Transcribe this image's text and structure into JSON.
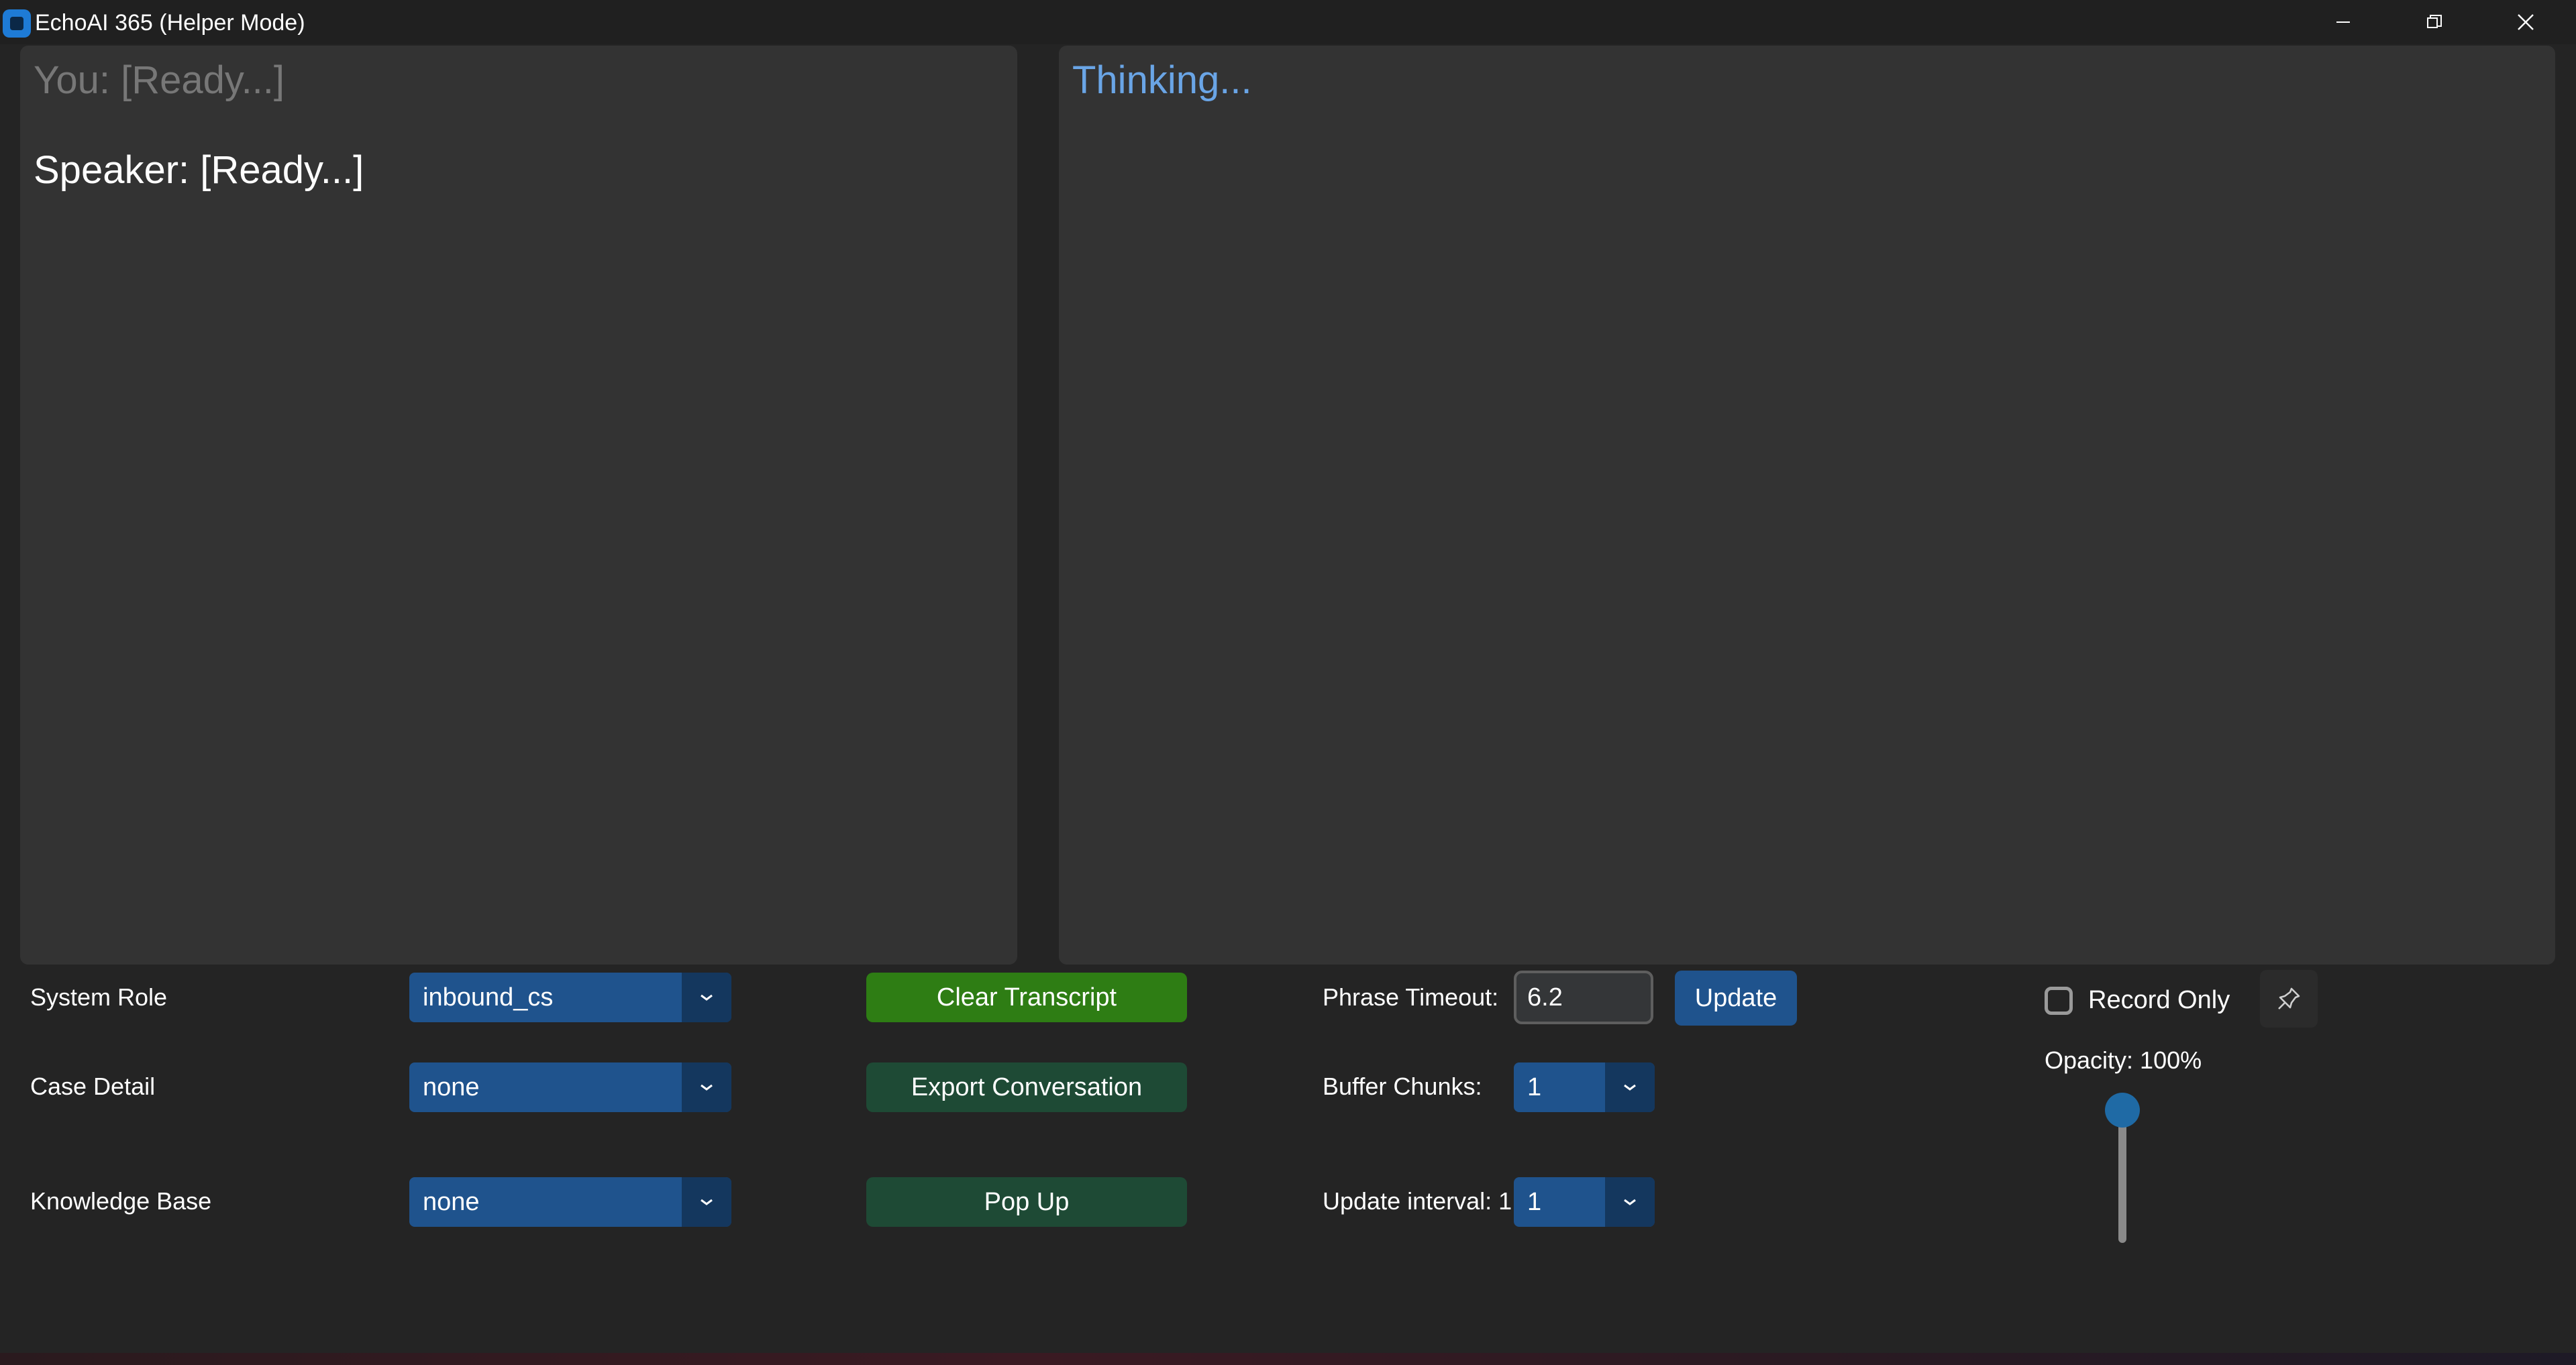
{
  "window": {
    "title": "EchoAI 365 (Helper Mode)"
  },
  "transcript": {
    "you": "You: [Ready...]",
    "speaker": "Speaker: [Ready...]"
  },
  "response": {
    "status": "Thinking..."
  },
  "controls": {
    "system_role": {
      "label": "System Role",
      "value": "inbound_cs"
    },
    "case_detail": {
      "label": "Case Detail",
      "value": "none"
    },
    "knowledge_base": {
      "label": "Knowledge Base",
      "value": "none"
    },
    "clear_transcript": "Clear Transcript",
    "export_conversation": "Export Conversation",
    "pop_up": "Pop Up",
    "phrase_timeout": {
      "label": "Phrase Timeout:",
      "value": "6.2"
    },
    "update_button": "Update",
    "buffer_chunks": {
      "label": "Buffer Chunks:",
      "value": "1"
    },
    "update_interval": {
      "label": "Update interval: 1",
      "value": "1"
    },
    "record_only": {
      "label": "Record Only",
      "checked": false
    },
    "opacity": {
      "label": "Opacity: 100%",
      "value": 100
    }
  },
  "icons": {
    "app": "app-icon",
    "minimize": "minimize-icon",
    "maximize": "restore-icon",
    "close": "close-icon",
    "pin": "pin-icon",
    "dropdown": "chevron-down-icon"
  },
  "colors": {
    "accent_blue": "#1f538d",
    "dropdown_arrow_bg": "#14375e",
    "clear_button": "#2e7d14",
    "secondary_button": "#1e4a35",
    "thinking_text": "#6aa5e6",
    "panel_bg": "#333333",
    "window_bg": "#242424"
  }
}
